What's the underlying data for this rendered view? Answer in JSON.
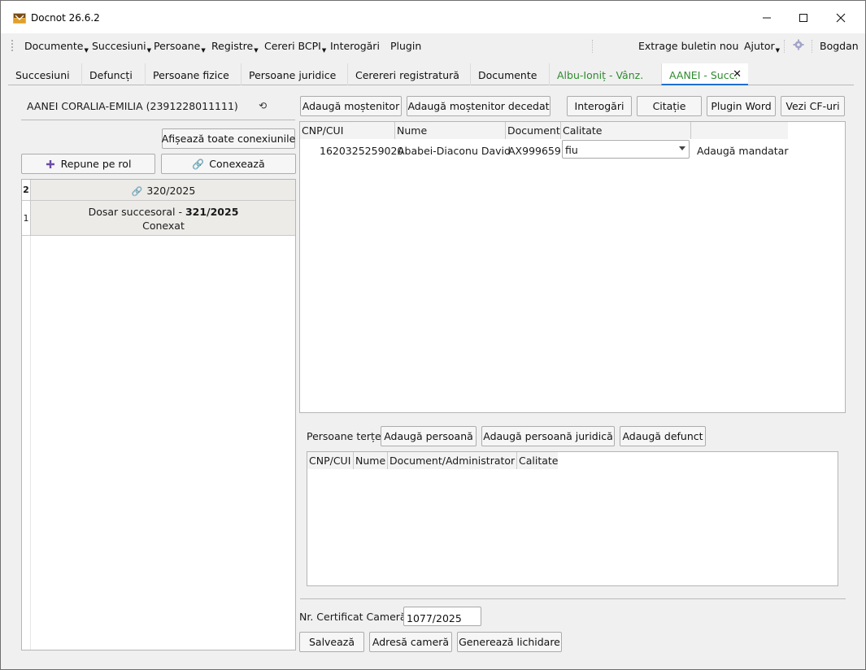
{
  "window": {
    "title": "Docnot 26.6.2",
    "controls": {
      "minimize": "—",
      "maximize": "☐",
      "close": "✕"
    }
  },
  "menubar": {
    "items": [
      "Documente",
      "Succesiuni",
      "Persoane",
      "Registre",
      "Cereri BCPI",
      "Interogări",
      "Plugin"
    ],
    "right": {
      "extract": "Extrage buletin nou",
      "help": "Ajutor",
      "user": "Bogdan"
    }
  },
  "tabs": [
    {
      "label": "Succesiuni"
    },
    {
      "label": "Defuncți"
    },
    {
      "label": "Persoane fizice"
    },
    {
      "label": "Persoane juridice"
    },
    {
      "label": "Cerereri registratură"
    },
    {
      "label": "Documente"
    },
    {
      "label": "Albu-Ioniț - Vânz."
    },
    {
      "label": "AANEI - Succ."
    }
  ],
  "left": {
    "person": "AANEI CORALIA-EMILIA (2391228011111)",
    "show_all_button": "Afișează toate conexiunile",
    "restore_button": "Repune pe rol",
    "connect_button": "Conexează",
    "rows": [
      {
        "num": "2",
        "title": "320/2025"
      },
      {
        "num": "1",
        "prefix": "Dosar succesoral - ",
        "number": "321/2025",
        "status": "Conexat"
      }
    ]
  },
  "toolbar": {
    "add_heir": "Adaugă moștenitor",
    "add_deceased_heir": "Adaugă moștenitor decedat",
    "queries": "Interogări",
    "summons": "Citație",
    "plugin_word": "Plugin Word",
    "view_cf": "Vezi CF-uri"
  },
  "heirs_table": {
    "columns": [
      "CNP/CUI",
      "Nume",
      "Document",
      "Calitate"
    ],
    "rows": [
      {
        "cnp": "1620325259020",
        "name": "Ababei-Diaconu David",
        "document": "AX999659",
        "quality": "fiu",
        "action": "Adaugă mandatar"
      }
    ]
  },
  "third_parties": {
    "label": "Persoane terțe",
    "add_person": "Adaugă persoană",
    "add_legal": "Adaugă persoană juridică",
    "add_deceased": "Adaugă defunct",
    "columns": [
      "CNP/CUI",
      "Nume",
      "Document/Administrator",
      "Calitate"
    ]
  },
  "footer": {
    "cert_label": "Nr. Certificat Cameră",
    "cert_value": "1077/2025",
    "save": "Salvează",
    "chamber_address": "Adresă cameră",
    "generate": "Generează lichidare"
  },
  "colors": {
    "active_tab_underline": "#1f6fd0",
    "green_tab_text": "#2e8b2e",
    "plus_icon": "#6a4ca8"
  }
}
